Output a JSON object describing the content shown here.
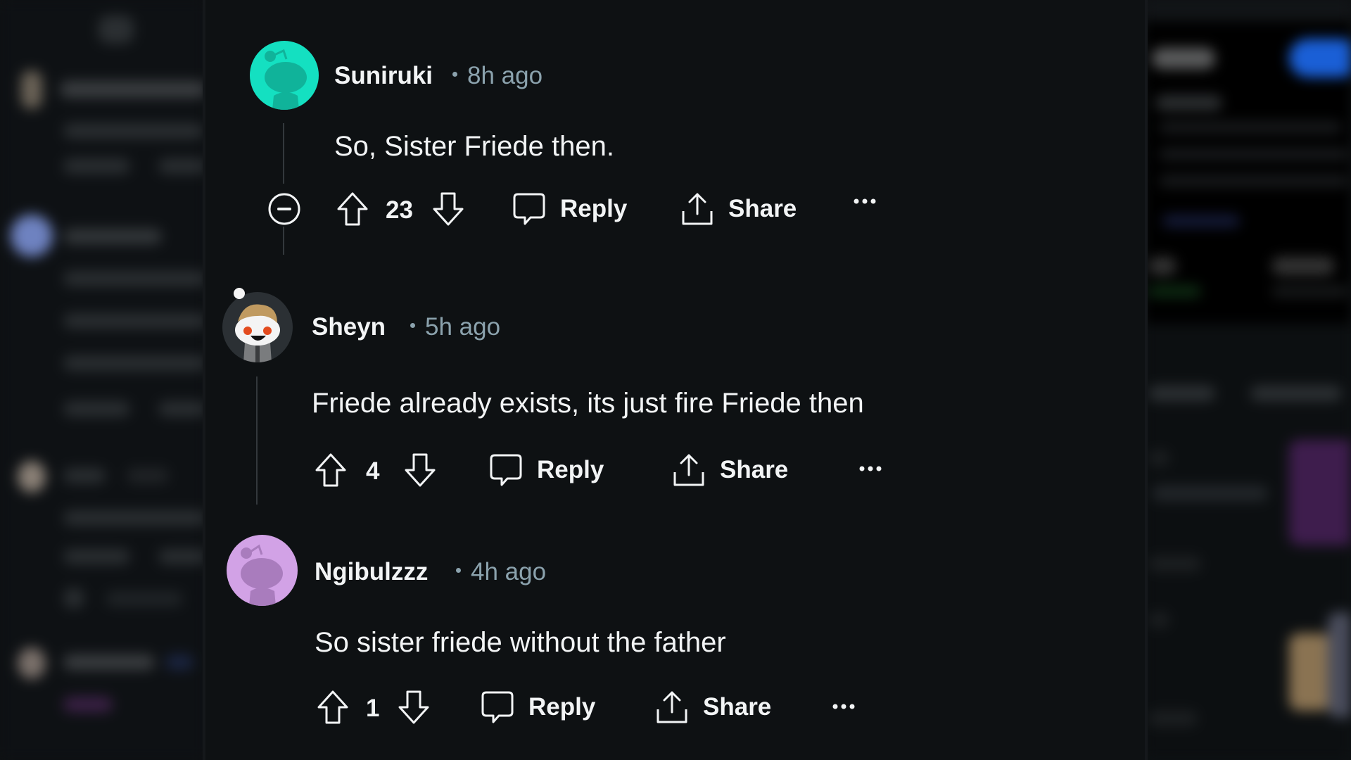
{
  "comments": [
    {
      "username": "Suniruki",
      "time": "8h ago",
      "body": "So, Sister Friede then.",
      "votes": "23",
      "reply_label": "Reply",
      "share_label": "Share",
      "more_label": "···",
      "avatar_color": "#14e0c1",
      "avatar_shade": "#10b39a"
    },
    {
      "username": "Sheyn",
      "time": "5h ago",
      "body": "Friede already exists, its just fire Friede then",
      "votes": "4",
      "reply_label": "Reply",
      "share_label": "Share",
      "more_label": "···",
      "avatar_color": "#2b3034"
    },
    {
      "username": "Ngibulzzz",
      "time": "4h ago",
      "body": "So sister friede without the father",
      "votes": "1",
      "reply_label": "Reply",
      "share_label": "Share",
      "more_label": "···",
      "avatar_color": "#d2a2e6",
      "avatar_shade": "#a97cbd"
    }
  ],
  "colors": {
    "background": "#0e1113",
    "text": "#f2f4f5",
    "meta": "#8ba2ad",
    "threadline": "#33383c",
    "right_panel_button": "#1a5fd6"
  }
}
